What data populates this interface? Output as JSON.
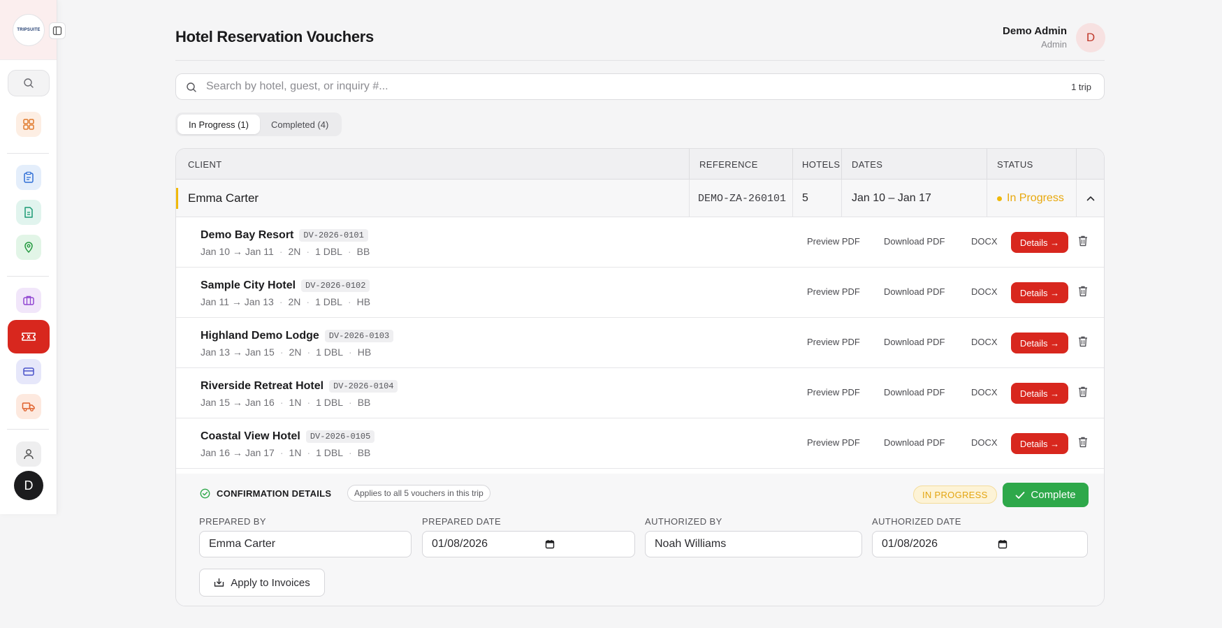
{
  "app": {
    "logo_text": "TRIPSUITE"
  },
  "header": {
    "title": "Hotel Reservation Vouchers"
  },
  "user": {
    "name": "Demo Admin",
    "role": "Admin",
    "avatar_letter": "D"
  },
  "sidebar": {
    "avatar_letter": "D"
  },
  "search": {
    "placeholder": "Search by hotel, guest, or inquiry #...",
    "value": "",
    "count": "1 trip"
  },
  "tabs": [
    {
      "label": "In Progress (1)",
      "active": true
    },
    {
      "label": "Completed (4)",
      "active": false
    }
  ],
  "table": {
    "columns": [
      "CLIENT",
      "REFERENCE",
      "HOTELS",
      "DATES",
      "STATUS"
    ],
    "trip": {
      "client": "Emma Carter",
      "reference": "DEMO-ZA-260101",
      "hotels": "5",
      "dates": "Jan 10 – Jan 17",
      "status": "In Progress"
    }
  },
  "actions": {
    "preview": "Preview PDF",
    "download": "Download PDF",
    "docx": "DOCX",
    "details": "Details →"
  },
  "vouchers": [
    {
      "name": "Demo Bay Resort",
      "code": "DV-2026-0101",
      "dates": "Jan 10 → Jan 11",
      "nights": "2N",
      "room": "1 DBL",
      "board": "BB"
    },
    {
      "name": "Sample City Hotel",
      "code": "DV-2026-0102",
      "dates": "Jan 11 → Jan 13",
      "nights": "2N",
      "room": "1 DBL",
      "board": "HB"
    },
    {
      "name": "Highland Demo Lodge",
      "code": "DV-2026-0103",
      "dates": "Jan 13 → Jan 15",
      "nights": "2N",
      "room": "1 DBL",
      "board": "HB"
    },
    {
      "name": "Riverside Retreat Hotel",
      "code": "DV-2026-0104",
      "dates": "Jan 15 → Jan 16",
      "nights": "1N",
      "room": "1 DBL",
      "board": "BB"
    },
    {
      "name": "Coastal View Hotel",
      "code": "DV-2026-0105",
      "dates": "Jan 16 → Jan 17",
      "nights": "1N",
      "room": "1 DBL",
      "board": "BB"
    }
  ],
  "confirmation": {
    "title": "CONFIRMATION DETAILS",
    "applies_note": "Applies to all 5 vouchers in this trip",
    "status_badge": "IN PROGRESS",
    "complete_label": "Complete",
    "prepared_by_label": "PREPARED BY",
    "prepared_by": "Emma Carter",
    "prepared_date_label": "PREPARED DATE",
    "prepared_date": "01/08/2026",
    "authorized_by_label": "AUTHORIZED BY",
    "authorized_by": "Noah Williams",
    "authorized_date_label": "AUTHORIZED DATE",
    "authorized_date": "01/08/2026",
    "apply_label": "Apply to Invoices"
  },
  "colors": {
    "accent": "#d8271e",
    "success": "#2ea84a",
    "warning": "#f0b90b"
  }
}
